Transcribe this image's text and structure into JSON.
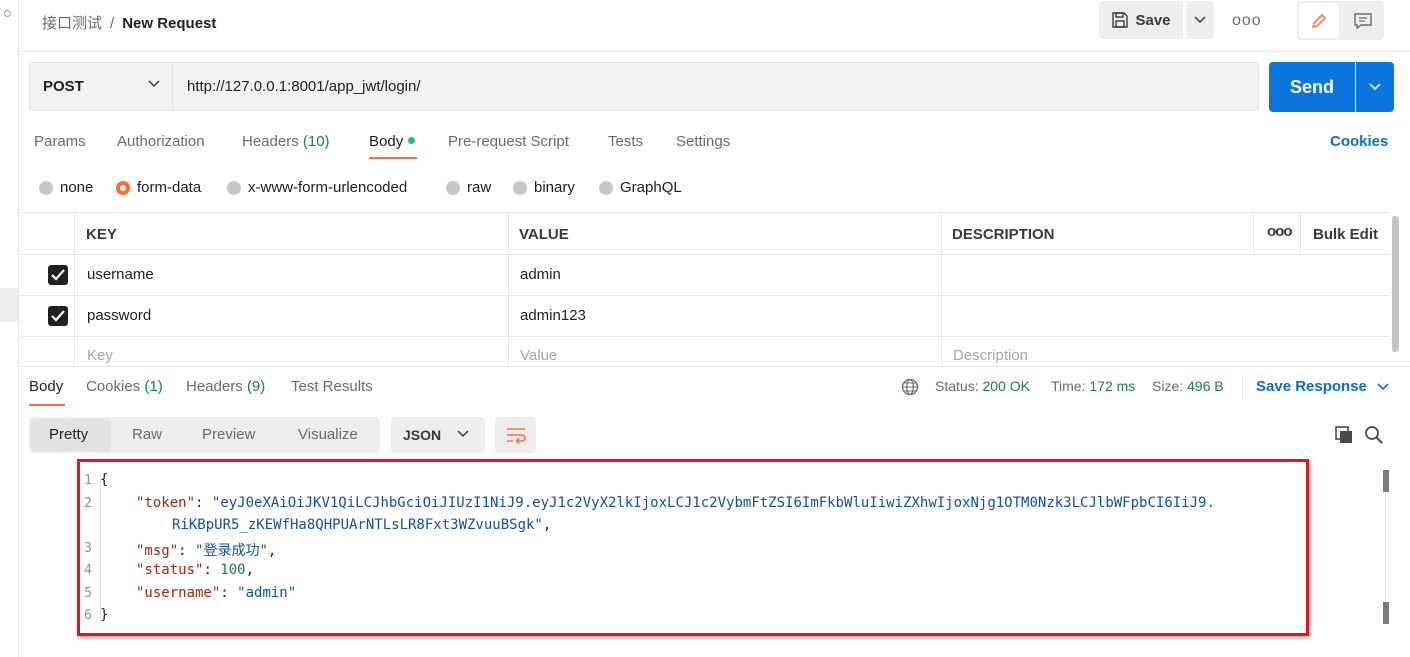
{
  "header": {
    "breadcrumb_parent": "接口测试",
    "breadcrumb_sep": "/",
    "breadcrumb_current": "New Request",
    "save_label": "Save",
    "more_label": "ooo"
  },
  "request": {
    "method": "POST",
    "url": "http://127.0.0.1:8001/app_jwt/login/",
    "send_label": "Send"
  },
  "request_tabs": {
    "params": "Params",
    "authorization": "Authorization",
    "headers": "Headers",
    "headers_count": "(10)",
    "body": "Body",
    "prerequest": "Pre-request Script",
    "tests": "Tests",
    "settings": "Settings",
    "cookies": "Cookies"
  },
  "body_types": {
    "none": "none",
    "form_data": "form-data",
    "urlencoded": "x-www-form-urlencoded",
    "raw": "raw",
    "binary": "binary",
    "graphql": "GraphQL",
    "selected": "form-data"
  },
  "params_table": {
    "col_key": "KEY",
    "col_value": "VALUE",
    "col_description": "DESCRIPTION",
    "more": "ooo",
    "bulk_edit": "Bulk Edit",
    "rows": [
      {
        "checked": true,
        "key": "username",
        "value": "admin",
        "description": ""
      },
      {
        "checked": true,
        "key": "password",
        "value": "admin123",
        "description": ""
      }
    ],
    "placeholder_key": "Key",
    "placeholder_value": "Value",
    "placeholder_description": "Description"
  },
  "response_tabs": {
    "body": "Body",
    "cookies": "Cookies",
    "cookies_count": "(1)",
    "headers": "Headers",
    "headers_count": "(9)",
    "test_results": "Test Results"
  },
  "response_status": {
    "status_label": "Status:",
    "status_value": "200 OK",
    "time_label": "Time:",
    "time_value": "172 ms",
    "size_label": "Size:",
    "size_value": "496 B",
    "save_response": "Save Response"
  },
  "view": {
    "pretty": "Pretty",
    "raw": "Raw",
    "preview": "Preview",
    "visualize": "Visualize",
    "format": "JSON"
  },
  "code": {
    "line_numbers": [
      "1",
      "2",
      "3",
      "4",
      "5",
      "6"
    ],
    "open_brace": "{",
    "close_brace": "}",
    "token_key": "\"token\"",
    "token_value_1": "\"eyJ0eXAiOiJKV1QiLCJhbGciOiJIUzI1NiJ9.eyJ1c2VyX2lkIjoxLCJ1c2VybmFtZSI6ImFkbWluIiwiZXhwIjoxNjg1OTM0Nzk3LCJlbWFpbCI6IiJ9.",
    "token_value_2": "RiKBpUR5_zKEWfHa8QHPUArNTLsLR8Fxt3WZvuuBSgk\"",
    "msg_key": "\"msg\"",
    "msg_value": "\"登录成功\"",
    "status_key": "\"status\"",
    "status_value": "100",
    "username_key": "\"username\"",
    "username_value": "\"admin\""
  },
  "colors": {
    "accent_orange": "#ff6c37",
    "send_blue": "#0b76e0",
    "link_blue": "#0b6ec5",
    "success_green": "#168248",
    "highlight_red": "#e0181e"
  }
}
